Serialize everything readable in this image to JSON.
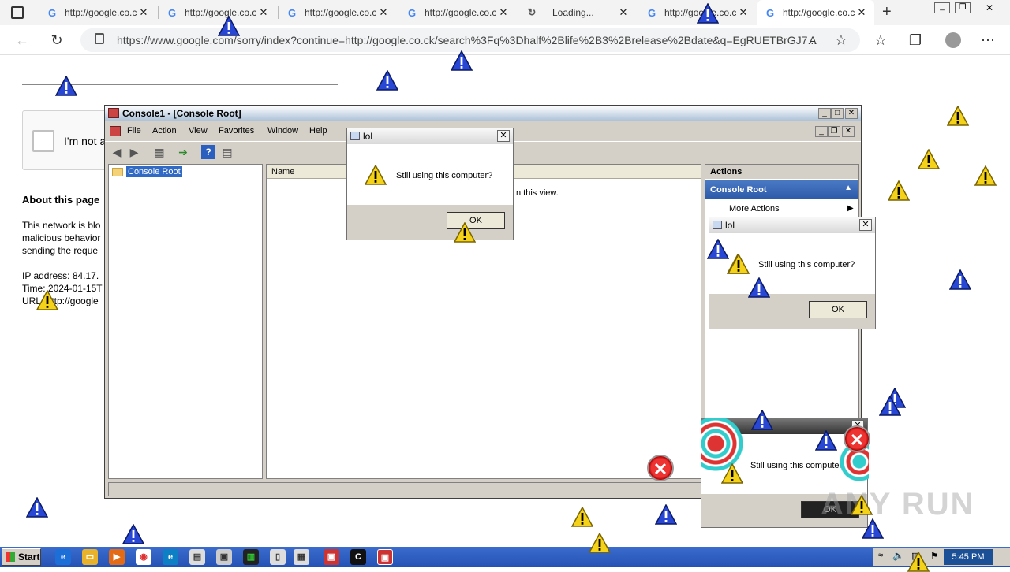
{
  "browser": {
    "tabs": [
      {
        "title": "http://google.co.ck",
        "favicon": "google-icon"
      },
      {
        "title": "http://google.co.ck",
        "favicon": "google-icon"
      },
      {
        "title": "http://google.co.ck",
        "favicon": "google-icon"
      },
      {
        "title": "http://google.co.ck",
        "favicon": "google-icon"
      },
      {
        "title": "Loading...",
        "favicon": "spinner-icon"
      },
      {
        "title": "http://google.co.ck",
        "favicon": "google-icon"
      },
      {
        "title": "http://google.co.ck",
        "favicon": "google-icon",
        "active": true
      }
    ],
    "url": "https://www.google.com/sorry/index?continue=http://google.co.ck/search%3Fq%3Dhalf%2Blife%2B3%2Brelease%2Bdate&q=EgRUETBrGJ7..."
  },
  "google_page": {
    "captcha_label": "I'm not a",
    "about_heading": "About this page",
    "lines": [
      "This network is blo",
      "malicious behavior",
      "sending the reque",
      "",
      "IP address: 84.17.",
      "Time: 2024-01-15T",
      "URL: http://google"
    ]
  },
  "mmc": {
    "title": "Console1 - [Console Root]",
    "menu": [
      "File",
      "Action",
      "View",
      "Favorites",
      "Window",
      "Help"
    ],
    "tree_root": "Console Root",
    "list_header": "Name",
    "empty_message": "n this view.",
    "actions_header": "Actions",
    "actions_section": "Console Root",
    "more_actions": "More Actions"
  },
  "dialogs": [
    {
      "title": "lol",
      "message": "Still using this computer?",
      "ok": "OK"
    },
    {
      "title": "lol",
      "message": "Still using this computer?",
      "ok": "OK"
    },
    {
      "title": "",
      "message": "Still using this computer?",
      "ok": "OK"
    }
  ],
  "taskbar": {
    "start": "Start",
    "clock": "5:45 PM"
  },
  "watermark": "ANY RUN"
}
